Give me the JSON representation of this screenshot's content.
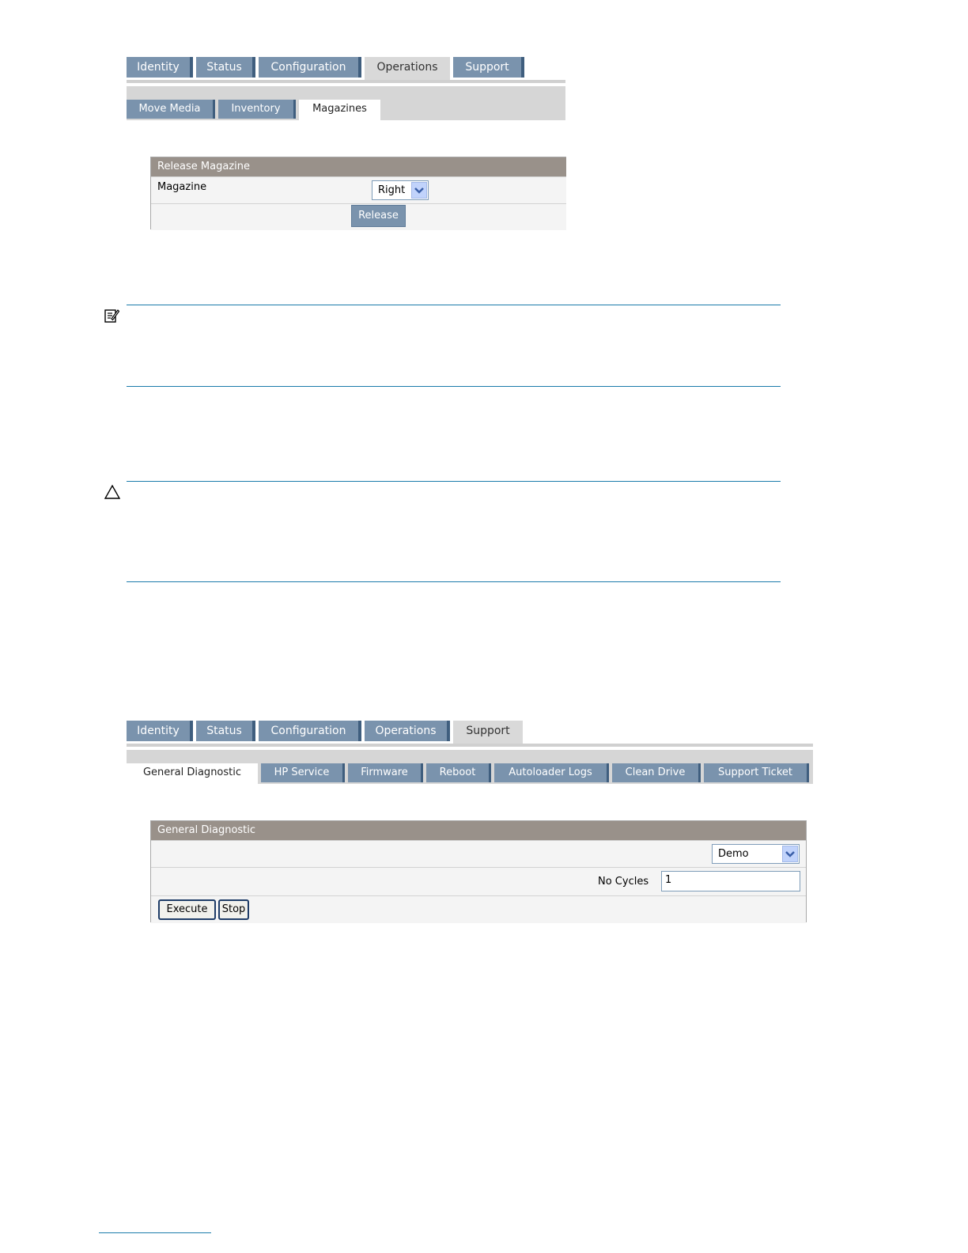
{
  "screen1": {
    "tabs": [
      "Identity",
      "Status",
      "Configuration",
      "Operations",
      "Support"
    ],
    "active_tab": "Operations",
    "subtabs": [
      "Move Media",
      "Inventory",
      "Magazines"
    ],
    "active_subtab": "Magazines",
    "panel": {
      "title": "Release Magazine",
      "magazine_label": "Magazine",
      "magazine_value": "Right",
      "release_label": "Release"
    }
  },
  "screen2": {
    "tabs": [
      "Identity",
      "Status",
      "Configuration",
      "Operations",
      "Support"
    ],
    "active_tab": "Support",
    "subtabs": [
      "General Diagnostic",
      "HP Service",
      "Firmware",
      "Reboot",
      "Autoloader Logs",
      "Clean Drive",
      "Support Ticket"
    ],
    "active_subtab": "General Diagnostic",
    "panel": {
      "title": "General Diagnostic",
      "test_value": "Demo",
      "cycles_label": "No Cycles",
      "cycles_value": "1",
      "execute_label": "Execute",
      "stop_label": "Stop"
    }
  },
  "icons": {
    "note": "note-icon",
    "caution": "caution-icon"
  },
  "colors": {
    "tab_blue": "#7a93ad",
    "panel_header": "#99918a",
    "rule_blue": "#1b7bab"
  }
}
